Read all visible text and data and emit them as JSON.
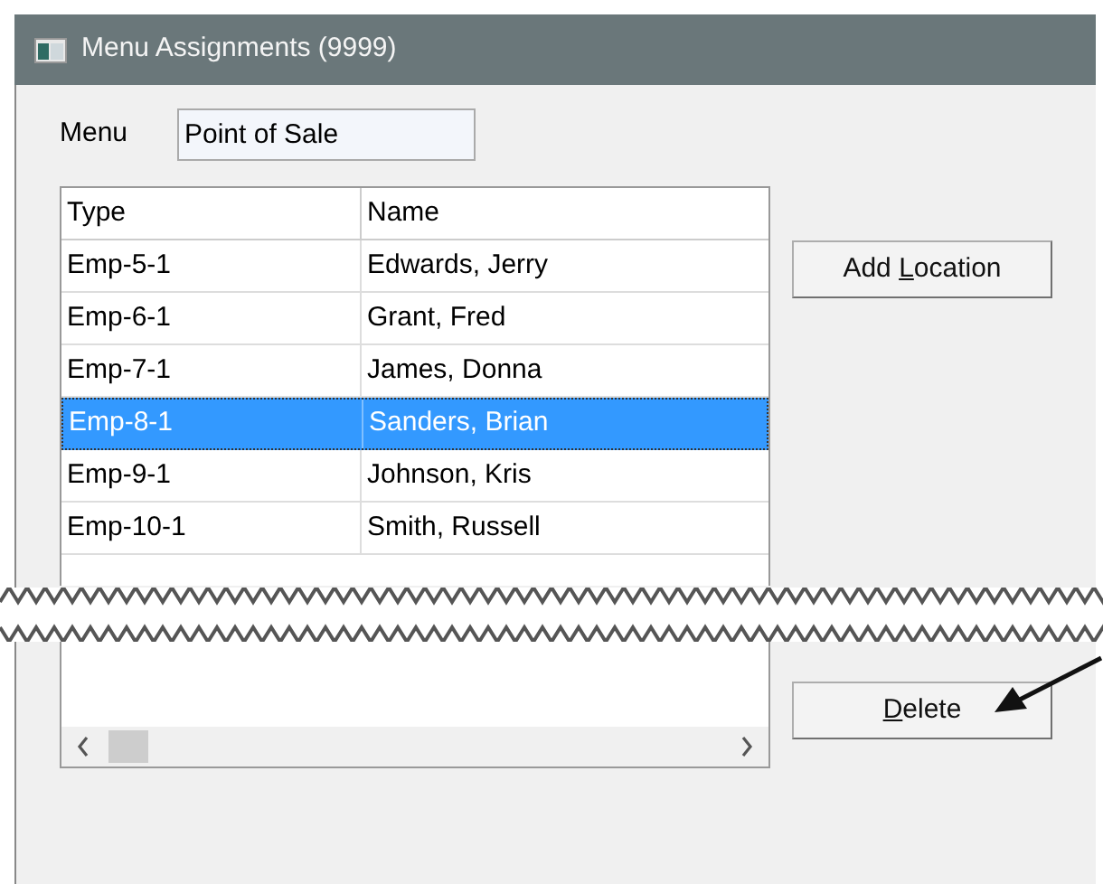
{
  "window": {
    "title": "Menu Assignments (9999)"
  },
  "menu_field": {
    "label": "Menu",
    "value": "Point of Sale"
  },
  "table": {
    "columns": [
      "Type",
      "Name"
    ],
    "rows": [
      {
        "cells": [
          "Emp-5-1",
          "Edwards, Jerry"
        ],
        "selected": false
      },
      {
        "cells": [
          "Emp-6-1",
          "Grant, Fred"
        ],
        "selected": false
      },
      {
        "cells": [
          "Emp-7-1",
          "James, Donna"
        ],
        "selected": false
      },
      {
        "cells": [
          "Emp-8-1",
          "Sanders, Brian"
        ],
        "selected": true
      },
      {
        "cells": [
          "Emp-9-1",
          "Johnson, Kris"
        ],
        "selected": false
      },
      {
        "cells": [
          "Emp-10-1",
          "Smith, Russell"
        ],
        "selected": false
      }
    ]
  },
  "buttons": [
    {
      "before": "Add ",
      "key": "L",
      "after": "ocation"
    },
    {
      "key": "D",
      "after": "elete"
    }
  ]
}
